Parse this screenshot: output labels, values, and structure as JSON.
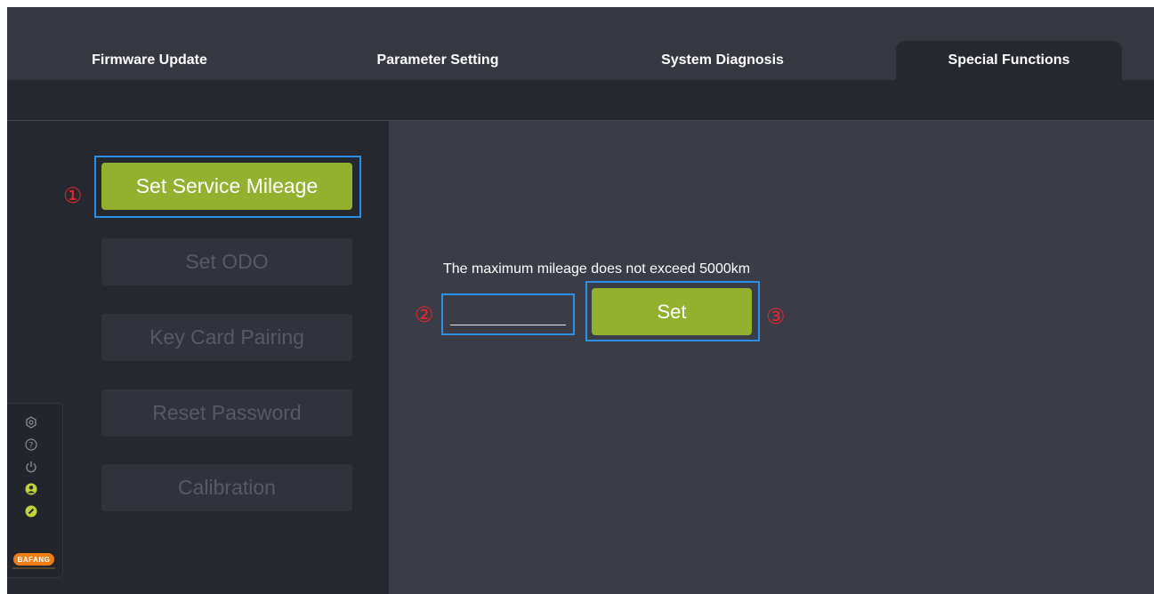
{
  "tabs": [
    {
      "label": "Firmware Update",
      "active": false
    },
    {
      "label": "Parameter Setting",
      "active": false
    },
    {
      "label": "System Diagnosis",
      "active": false
    },
    {
      "label": "Special Functions",
      "active": true
    }
  ],
  "menu": {
    "items": [
      {
        "label": "Set Service Mileage",
        "active": true
      },
      {
        "label": "Set ODO",
        "active": false
      },
      {
        "label": "Key Card Pairing",
        "active": false
      },
      {
        "label": "Reset Password",
        "active": false
      },
      {
        "label": "Calibration",
        "active": false
      }
    ]
  },
  "main": {
    "hint": "The maximum mileage does not exceed 5000km",
    "mileage_value": "",
    "set_label": "Set"
  },
  "annotations": {
    "step1": "①",
    "step2": "②",
    "step3": "③"
  },
  "sidebar_icons": [
    "settings-icon",
    "help-icon",
    "power-icon",
    "user-icon",
    "link-icon"
  ],
  "brand": {
    "logo_text": "BAFANG"
  },
  "colors": {
    "accent_green": "#93b12e",
    "highlight_blue": "#2c8fe6",
    "annotation_red": "#e8262d",
    "logo_orange": "#f07c12"
  }
}
